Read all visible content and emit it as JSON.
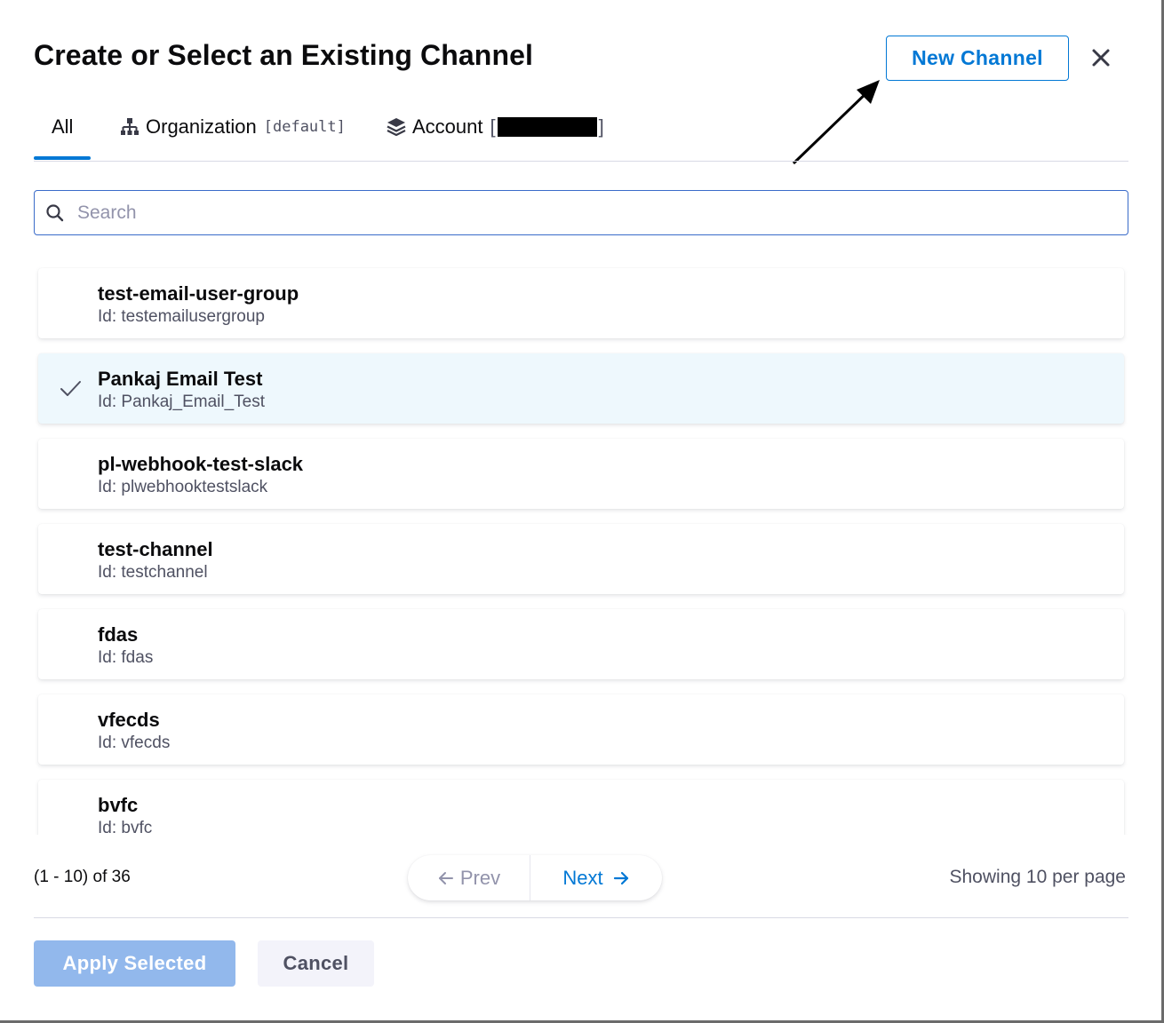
{
  "dialog": {
    "title": "Create or Select an Existing Channel",
    "new_channel_label": "New Channel"
  },
  "tabs": [
    {
      "label": "All",
      "sub": "",
      "active": true
    },
    {
      "label": "Organization",
      "sub": "[default]",
      "icon": "org-hierarchy-icon"
    },
    {
      "label": "Account",
      "sub_prefix": "[",
      "sub_suffix": "]",
      "icon": "layers-icon",
      "redacted": true
    }
  ],
  "search": {
    "placeholder": "Search",
    "value": ""
  },
  "channels": [
    {
      "name": "test-email-user-group",
      "id": "Id: testemailusergroup",
      "selected": false
    },
    {
      "name": "Pankaj Email Test",
      "id": "Id: Pankaj_Email_Test",
      "selected": true
    },
    {
      "name": "pl-webhook-test-slack",
      "id": "Id: plwebhooktestslack",
      "selected": false
    },
    {
      "name": "test-channel",
      "id": "Id: testchannel",
      "selected": false
    },
    {
      "name": "fdas",
      "id": "Id: fdas",
      "selected": false
    },
    {
      "name": "vfecds",
      "id": "Id: vfecds",
      "selected": false
    },
    {
      "name": "bvfc",
      "id": "Id: bvfc",
      "selected": false
    }
  ],
  "pagination": {
    "count_text": "(1 - 10) of 36",
    "prev_label": "Prev",
    "next_label": "Next",
    "per_page_text": "Showing 10 per page"
  },
  "footer": {
    "apply_label": "Apply Selected",
    "cancel_label": "Cancel"
  },
  "colors": {
    "accent": "#0278d5",
    "selected_row": "#eef8fd",
    "apply_disabled": "#92b8ec"
  }
}
